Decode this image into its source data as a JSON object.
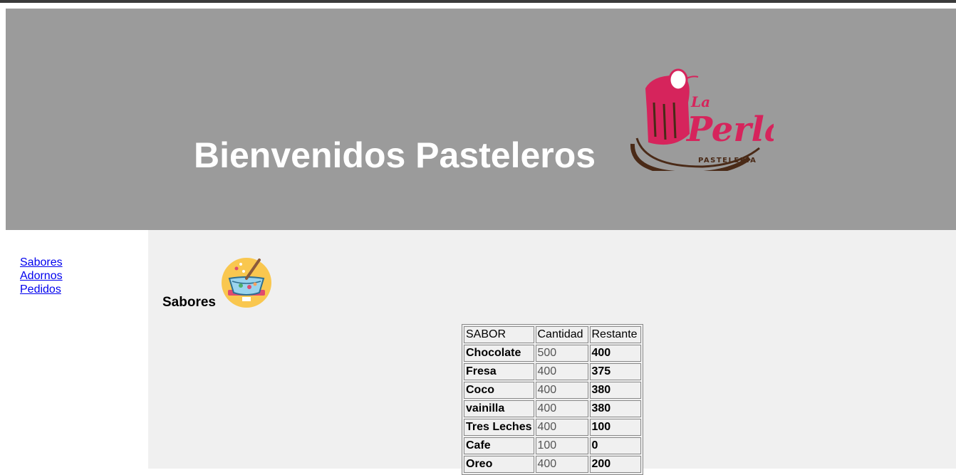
{
  "header": {
    "title": "Bienvenidos Pasteleros",
    "logo": {
      "line1": "La",
      "line2": "Perla",
      "line3": "PASTELERÍA",
      "accent_color": "#d6245c",
      "base_color": "#4a2a17"
    }
  },
  "sidebar": {
    "links": [
      {
        "label": "Sabores"
      },
      {
        "label": "Adornos"
      },
      {
        "label": "Pedidos"
      }
    ]
  },
  "section": {
    "title": "Sabores",
    "icon": "mixing-bowl-icon"
  },
  "table": {
    "headers": [
      "SABOR",
      "Cantidad",
      "Restante"
    ],
    "rows": [
      {
        "sabor": "Chocolate",
        "cantidad": "500",
        "restante": "400"
      },
      {
        "sabor": "Fresa",
        "cantidad": "400",
        "restante": "375"
      },
      {
        "sabor": "Coco",
        "cantidad": "400",
        "restante": "380"
      },
      {
        "sabor": "vainilla",
        "cantidad": "400",
        "restante": "380"
      },
      {
        "sabor": "Tres Leches",
        "cantidad": "400",
        "restante": "100"
      },
      {
        "sabor": "Cafe",
        "cantidad": "100",
        "restante": "0"
      },
      {
        "sabor": "Oreo",
        "cantidad": "400",
        "restante": "200"
      }
    ]
  }
}
